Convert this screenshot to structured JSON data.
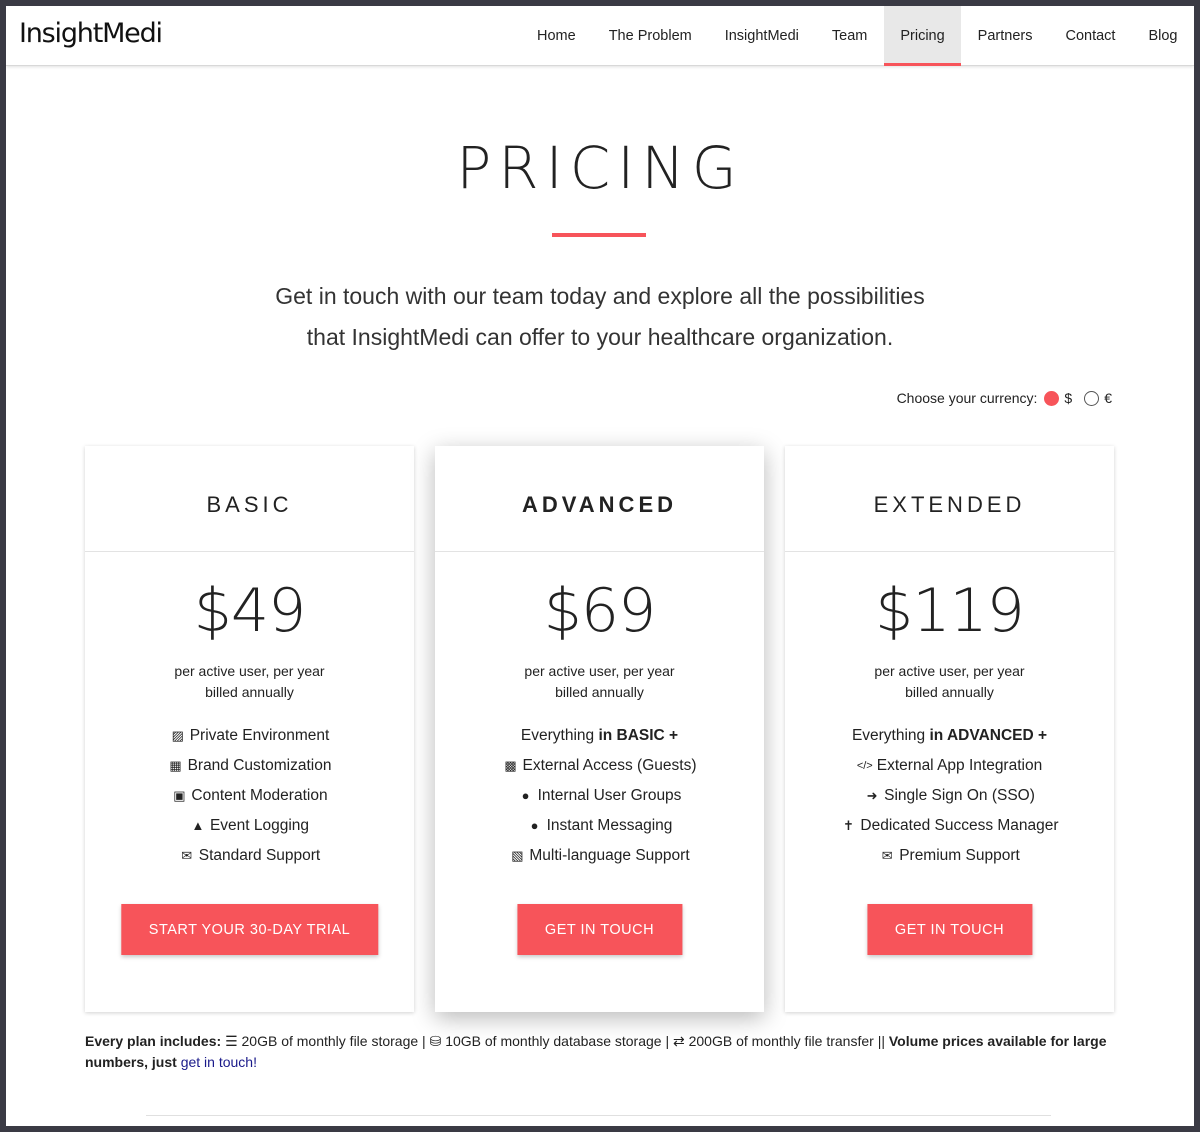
{
  "nav": {
    "logo": "InsightMedi",
    "links": [
      "Home",
      "The Problem",
      "InsightMedi",
      "Team",
      "Pricing",
      "Partners",
      "Contact",
      "Blog"
    ],
    "active": "Pricing"
  },
  "hero": {
    "title": "PRICING",
    "subtitle_line1": "Get in touch with our team today and explore all the possibilities",
    "subtitle_line2": "that InsightMedi can offer to your healthcare organization."
  },
  "currency": {
    "label": "Choose your currency:",
    "options": [
      "$",
      "€"
    ],
    "selected": "$"
  },
  "plans": [
    {
      "name": "BASIC",
      "price": "$49",
      "per_line1": "per active user, per year",
      "per_line2": "billed annually",
      "features": [
        {
          "icon": "lock-file-icon",
          "text": "Private Environment"
        },
        {
          "icon": "building-icon",
          "text": "Brand Customization"
        },
        {
          "icon": "image-icon",
          "text": "Content Moderation"
        },
        {
          "icon": "binoculars-icon",
          "text": "Event Logging"
        },
        {
          "icon": "envelope-icon",
          "text": "Standard Support"
        }
      ],
      "cta": "START YOUR 30-DAY TRIAL"
    },
    {
      "name": "ADVANCED",
      "price": "$69",
      "per_line1": "per active user, per year",
      "per_line2": "billed annually",
      "includes_prefix": "Everything ",
      "includes_bold": "in BASIC +",
      "features": [
        {
          "icon": "id-card-icon",
          "text": "External Access (Guests)"
        },
        {
          "icon": "users-icon",
          "text": "Internal User Groups"
        },
        {
          "icon": "comments-icon",
          "text": "Instant Messaging"
        },
        {
          "icon": "language-icon",
          "text": "Multi-language Support"
        }
      ],
      "cta": "GET IN TOUCH"
    },
    {
      "name": "EXTENDED",
      "price": "$119",
      "per_line1": "per active user, per year",
      "per_line2": "billed annually",
      "includes_prefix": "Everything ",
      "includes_bold": "in ADVANCED +",
      "features": [
        {
          "icon": "code-icon",
          "text": "External App Integration"
        },
        {
          "icon": "sign-in-icon",
          "text": "Single Sign On (SSO)"
        },
        {
          "icon": "person-icon",
          "text": "Dedicated Success Manager"
        },
        {
          "icon": "envelope-icon",
          "text": "Premium Support"
        }
      ],
      "cta": "GET IN TOUCH"
    }
  ],
  "footnote": {
    "lead": "Every plan includes:",
    "item1": " 20GB of monthly file storage | ",
    "item2": " 10GB of monthly database storage | ",
    "item3": " 200GB of monthly file transfer || ",
    "volume": "Volume prices available for large numbers, just",
    "link": "get in touch!"
  },
  "colors": {
    "accent": "#f7545a",
    "link": "#1a1a8a"
  }
}
